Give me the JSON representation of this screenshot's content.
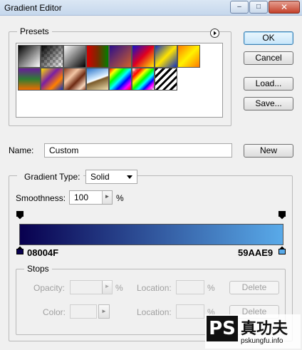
{
  "window": {
    "title": "Gradient Editor",
    "min_glyph": "–",
    "max_glyph": "□",
    "close_glyph": "✕"
  },
  "buttons": {
    "ok": "OK",
    "cancel": "Cancel",
    "load": "Load...",
    "save": "Save...",
    "new": "New",
    "delete_opacity": "Delete",
    "delete_color": "Delete"
  },
  "presets": {
    "label": "Presets",
    "menu_icon": "circle-arrow-right-icon",
    "swatches": [
      {
        "id": "black-white"
      },
      {
        "id": "black-transparent"
      },
      {
        "id": "white-black"
      },
      {
        "id": "red-green"
      },
      {
        "id": "violet-orange"
      },
      {
        "id": "blue-red-yellow"
      },
      {
        "id": "blue-yellow-blue"
      },
      {
        "id": "orange-yellow-orange"
      },
      {
        "id": "violet-green-orange"
      },
      {
        "id": "yellow-violet-orange-blue"
      },
      {
        "id": "copper"
      },
      {
        "id": "chrome"
      },
      {
        "id": "spectrum"
      },
      {
        "id": "transparent-rainbow"
      },
      {
        "id": "transparent-stripes"
      }
    ]
  },
  "name": {
    "label": "Name:",
    "value": "Custom"
  },
  "gradient": {
    "type_label": "Gradient Type:",
    "type_value": "Solid",
    "smoothness_label": "Smoothness:",
    "smoothness_value": "100",
    "smoothness_unit": "%",
    "left_color": "#08004F",
    "right_color": "#59AAE9",
    "left_color_label": "08004F",
    "right_color_label": "59AAE9"
  },
  "stops": {
    "label": "Stops",
    "opacity_label": "Opacity:",
    "opacity_unit": "%",
    "location_label_1": "Location:",
    "location_unit_1": "%",
    "color_label": "Color:",
    "location_label_2": "Location:",
    "location_unit_2": "%"
  },
  "watermark": {
    "logo_text": "PS",
    "chinese_text": "真功夫",
    "url": "pskungfu.info"
  }
}
